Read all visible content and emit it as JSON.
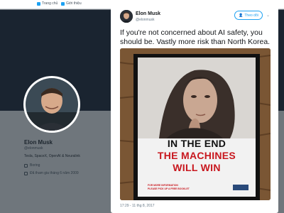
{
  "nav": {
    "home_label": "Trang chủ",
    "notifications_label": "Giới thiệu"
  },
  "profile": {
    "name": "Elon Musk",
    "handle": "@elonmusk",
    "bio": "Tesla, SpaceX, OpenAI & Neuralink",
    "location": "Boring",
    "joined": "Đã tham gia tháng 6 năm 2009"
  },
  "tweet": {
    "author_name": "Elon Musk",
    "author_handle": "@elonmusk",
    "follow_label": "Theo dõi",
    "text": "If you're not concerned about AI safety, you should be. Vastly more risk than North Korea.",
    "timestamp": "17:29 - 11 thg 8, 2017"
  },
  "poster": {
    "line1": "IN THE END",
    "line2": "THE MACHINES",
    "line3": "WILL WIN",
    "info1": "FOR MORE INFORMATION",
    "info2": "PLEASE PICK UP A FREE BOOKLET"
  },
  "colors": {
    "accent": "#1da1f2",
    "poster_red": "#c8171e",
    "banner": "#1a2430"
  }
}
